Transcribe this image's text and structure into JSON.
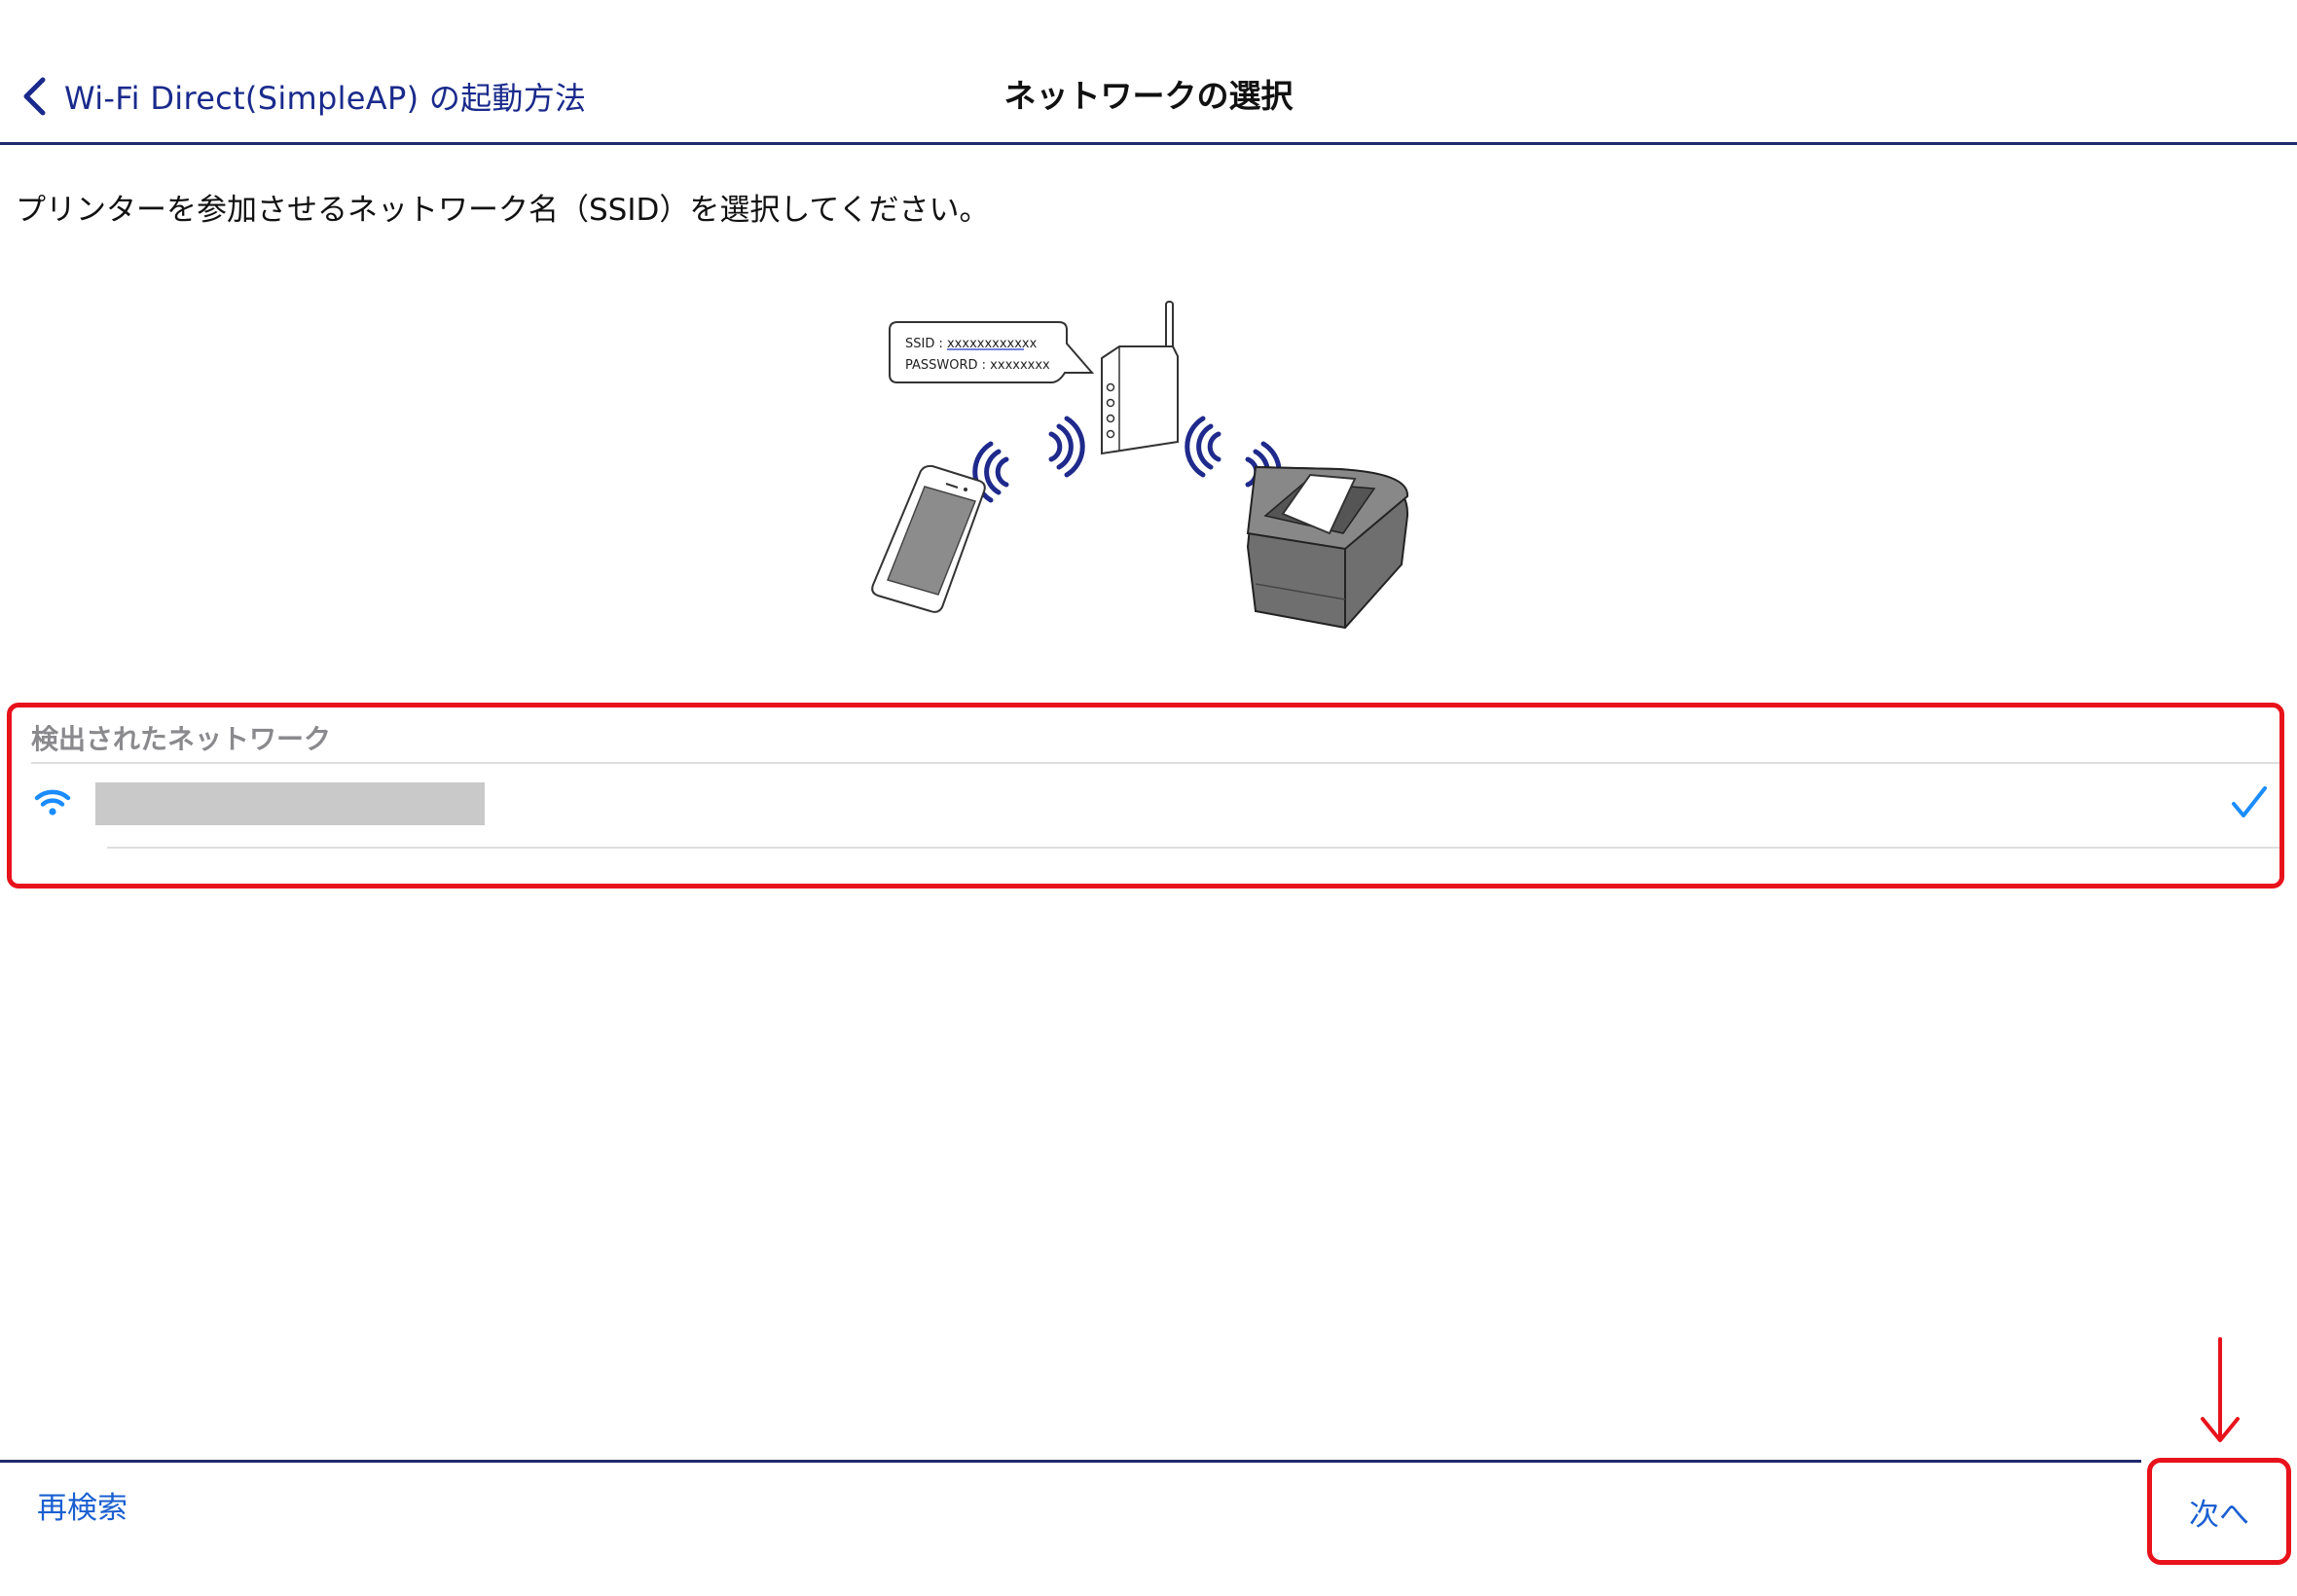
{
  "nav": {
    "back_label": "Wi-Fi Direct(SimpleAP) の起動方法",
    "title": "ネットワークの選択"
  },
  "instruction": "プリンターを参加させるネットワーク名（SSID）を選択してください。",
  "illustration": {
    "ssid_line": "SSID : xxxxxxxxxxxx",
    "password_line": "PASSWORD : xxxxxxxx"
  },
  "network_section": {
    "header": "検出されたネットワーク",
    "networks": [
      {
        "ssid": "",
        "selected": true,
        "icon": "wifi-icon",
        "redacted": true
      }
    ]
  },
  "toolbar": {
    "rescan_label": "再検索",
    "next_label": "次へ"
  },
  "colors": {
    "link_blue": "#1a5fd1",
    "nav_blue": "#1a2a8c",
    "divider_navy": "#1f2a6e",
    "highlight_red": "#e8121b",
    "wifi_blue": "#1a8cff"
  }
}
